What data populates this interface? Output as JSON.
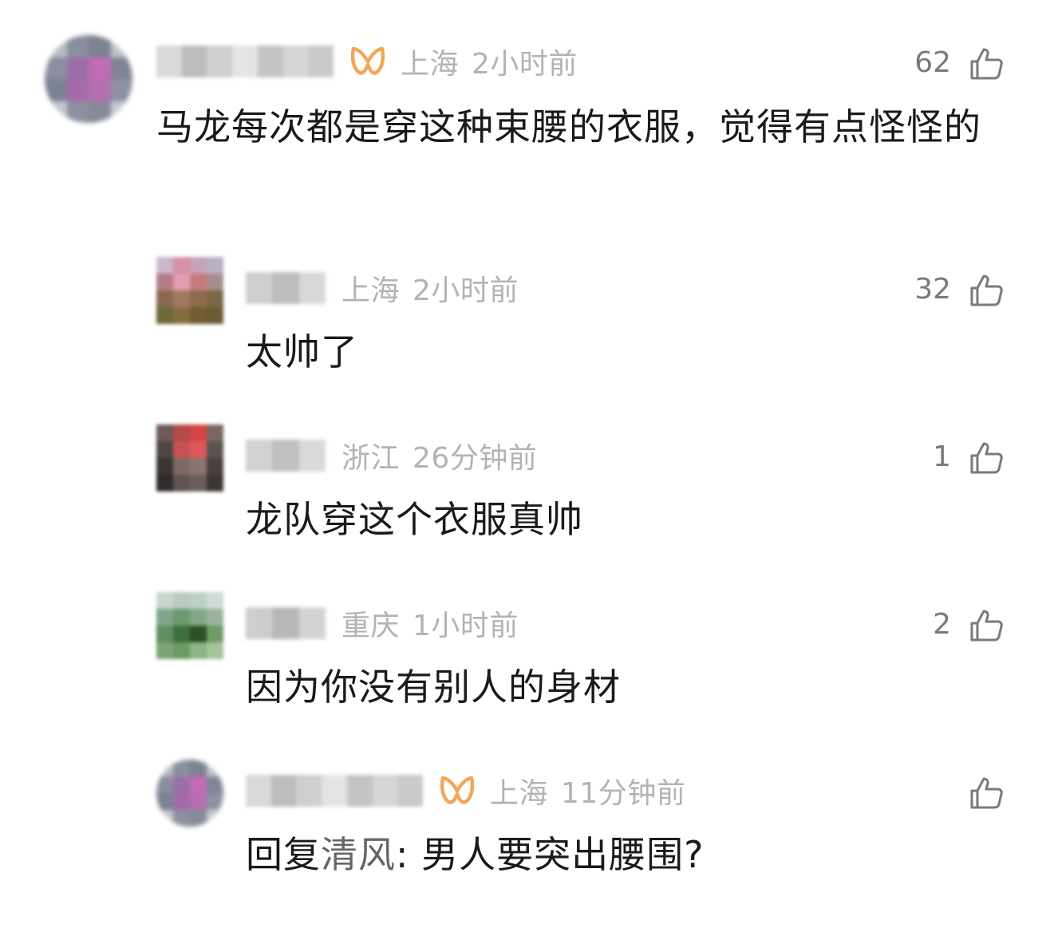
{
  "comments": [
    {
      "location": "上海",
      "time": "2小时前",
      "likes": "62",
      "has_badge": true,
      "text": "马龙每次都是穿这种束腰的衣服，觉得有点怪怪的"
    },
    {
      "location": "上海",
      "time": "2小时前",
      "likes": "32",
      "has_badge": false,
      "text": "太帅了"
    },
    {
      "location": "浙江",
      "time": "26分钟前",
      "likes": "1",
      "has_badge": false,
      "text": "龙队穿这个衣服真帅"
    },
    {
      "location": "重庆",
      "time": "1小时前",
      "likes": "2",
      "has_badge": false,
      "text": "因为你没有别人的身材"
    },
    {
      "location": "上海",
      "time": "11分钟前",
      "likes": "",
      "has_badge": true,
      "reply_prefix": "回复",
      "reply_target": "清风",
      "reply_sep": ": ",
      "text": "男人要突出腰围?"
    }
  ],
  "icons": {
    "like": "thumbs-up-icon",
    "badge": "member-badge-icon"
  },
  "colors": {
    "badge": "#f2a65a",
    "meta_text": "#b3b3b3",
    "like_count": "#7a7a7a",
    "body_text": "#1a1a1a",
    "reply_target": "#666666"
  }
}
